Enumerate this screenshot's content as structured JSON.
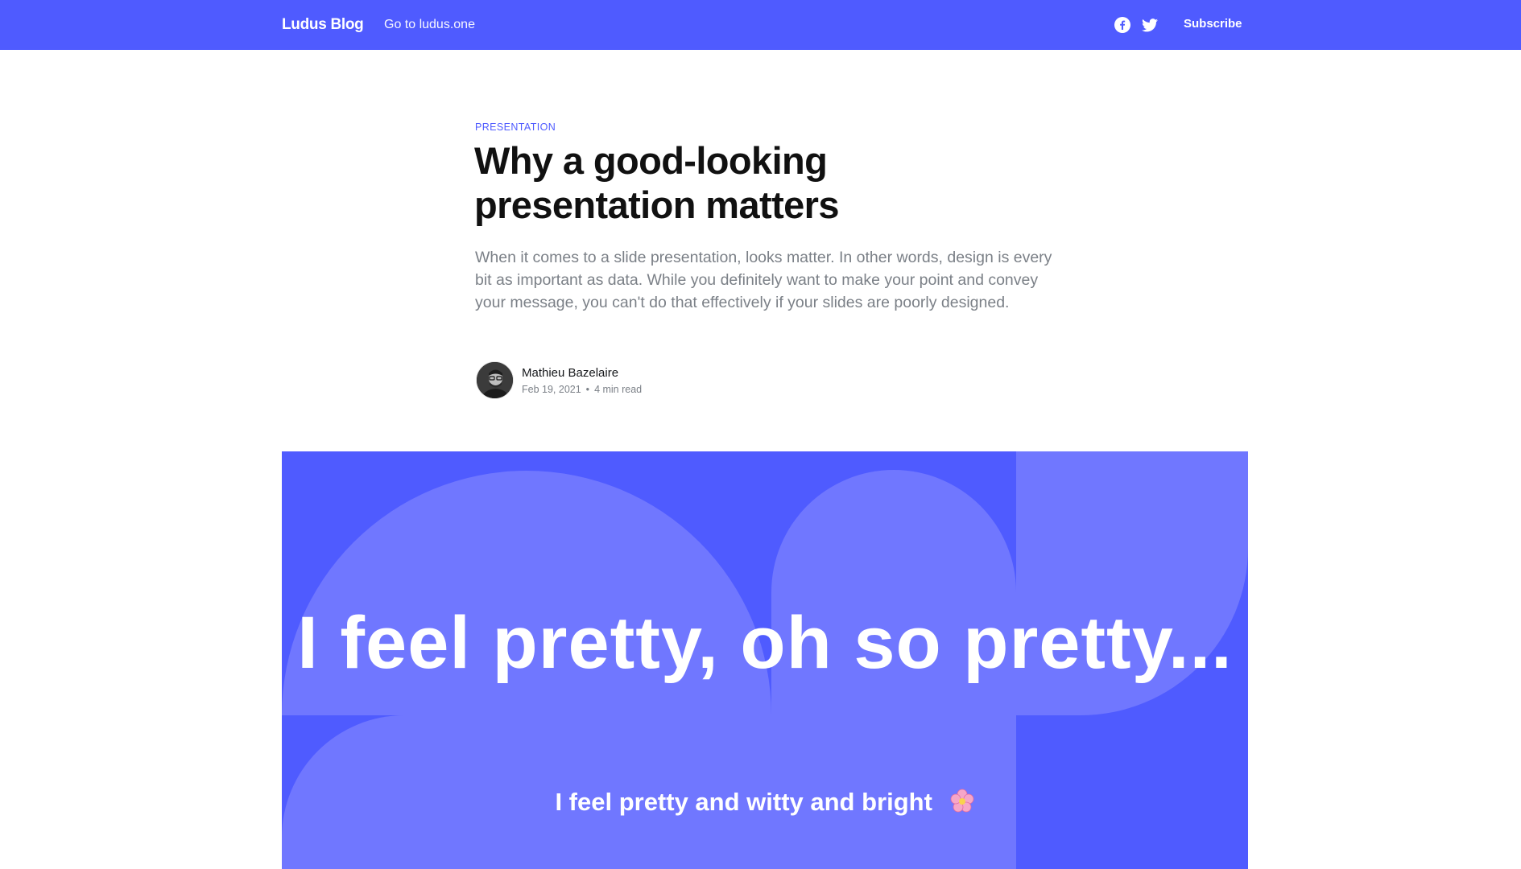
{
  "header": {
    "brand": "Ludus Blog",
    "nav_link": "Go to ludus.one",
    "social": [
      {
        "icon": "facebook-icon"
      },
      {
        "icon": "twitter-icon"
      }
    ],
    "subscribe_label": "Subscribe",
    "background_color": "#4f5bff"
  },
  "article": {
    "tag": "PRESENTATION",
    "title": "Why a good-looking presentation matters",
    "excerpt": "When it comes to a slide presentation, looks matter. In other words, design is every bit as important as data. While you definitely want to make your point and convey your message, you can't do that effectively if your slides are poorly designed.",
    "author": {
      "name": "Mathieu Bazelaire",
      "avatar_icon": "author-avatar"
    },
    "date": "Feb 19, 2021",
    "separator": "•",
    "reading_time": "4 min read"
  },
  "feature_image": {
    "headline": "I feel pretty, oh so pretty...",
    "subline": "I feel pretty and witty and bright",
    "emoji_icon": "cherry-blossom-icon",
    "background_color": "#4f5bff",
    "shape_color": "#7077ff"
  }
}
